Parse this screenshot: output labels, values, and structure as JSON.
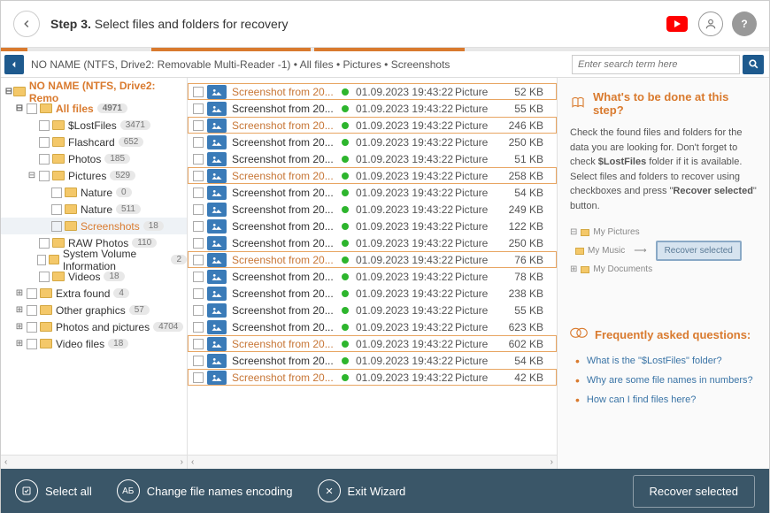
{
  "header": {
    "step": "Step 3.",
    "title": "Select files and folders for recovery"
  },
  "breadcrumb": "NO NAME (NTFS, Drive2: Removable Multi-Reader  -1)  •  All files  •  Pictures  •  Screenshots",
  "search": {
    "placeholder": "Enter search term here"
  },
  "tree": [
    {
      "lvl": 1,
      "tog": "⊟",
      "label": "NO NAME (NTFS, Drive2: Remo",
      "cls": "root"
    },
    {
      "lvl": 2,
      "tog": "⊟",
      "label": "All files",
      "cnt": "4971",
      "cls": "af"
    },
    {
      "lvl": 3,
      "tog": "",
      "label": "$LostFiles",
      "cnt": "3471"
    },
    {
      "lvl": 3,
      "tog": "",
      "label": "Flashcard",
      "cnt": "652"
    },
    {
      "lvl": 3,
      "tog": "",
      "label": "Photos",
      "cnt": "185"
    },
    {
      "lvl": 3,
      "tog": "⊟",
      "label": "Pictures",
      "cnt": "529"
    },
    {
      "lvl": 4,
      "tog": "",
      "label": "Nature",
      "cnt": "0"
    },
    {
      "lvl": 4,
      "tog": "",
      "label": "Nature",
      "cnt": "511"
    },
    {
      "lvl": 4,
      "tog": "",
      "label": "Screenshots",
      "cnt": "18",
      "cls": "sel"
    },
    {
      "lvl": 3,
      "tog": "",
      "label": "RAW Photos",
      "cnt": "110"
    },
    {
      "lvl": 3,
      "tog": "",
      "label": "System Volume Information",
      "cnt": "2"
    },
    {
      "lvl": 3,
      "tog": "",
      "label": "Videos",
      "cnt": "18"
    },
    {
      "lvl": 2,
      "tog": "⊞",
      "label": "Extra found",
      "cnt": "4"
    },
    {
      "lvl": 2,
      "tog": "⊞",
      "label": "Other graphics",
      "cnt": "57"
    },
    {
      "lvl": 2,
      "tog": "⊞",
      "label": "Photos and pictures",
      "cnt": "4704"
    },
    {
      "lvl": 2,
      "tog": "⊞",
      "label": "Video files",
      "cnt": "18"
    }
  ],
  "files": [
    {
      "hl": true,
      "name": "Screenshot from 20...",
      "date": "01.09.2023 19:43:22",
      "type": "Picture",
      "size": "52 KB"
    },
    {
      "hl": false,
      "name": "Screenshot from 20...",
      "date": "01.09.2023 19:43:22",
      "type": "Picture",
      "size": "55 KB"
    },
    {
      "hl": true,
      "name": "Screenshot from 20...",
      "date": "01.09.2023 19:43:22",
      "type": "Picture",
      "size": "246 KB"
    },
    {
      "hl": false,
      "name": "Screenshot from 20...",
      "date": "01.09.2023 19:43:22",
      "type": "Picture",
      "size": "250 KB"
    },
    {
      "hl": false,
      "name": "Screenshot from 20...",
      "date": "01.09.2023 19:43:22",
      "type": "Picture",
      "size": "51 KB"
    },
    {
      "hl": true,
      "name": "Screenshot from 20...",
      "date": "01.09.2023 19:43:22",
      "type": "Picture",
      "size": "258 KB"
    },
    {
      "hl": false,
      "name": "Screenshot from 20...",
      "date": "01.09.2023 19:43:22",
      "type": "Picture",
      "size": "54 KB"
    },
    {
      "hl": false,
      "name": "Screenshot from 20...",
      "date": "01.09.2023 19:43:22",
      "type": "Picture",
      "size": "249 KB"
    },
    {
      "hl": false,
      "name": "Screenshot from 20...",
      "date": "01.09.2023 19:43:22",
      "type": "Picture",
      "size": "122 KB"
    },
    {
      "hl": false,
      "name": "Screenshot from 20...",
      "date": "01.09.2023 19:43:22",
      "type": "Picture",
      "size": "250 KB"
    },
    {
      "hl": true,
      "name": "Screenshot from 20...",
      "date": "01.09.2023 19:43:22",
      "type": "Picture",
      "size": "76 KB"
    },
    {
      "hl": false,
      "name": "Screenshot from 20...",
      "date": "01.09.2023 19:43:22",
      "type": "Picture",
      "size": "78 KB"
    },
    {
      "hl": false,
      "name": "Screenshot from 20...",
      "date": "01.09.2023 19:43:22",
      "type": "Picture",
      "size": "238 KB"
    },
    {
      "hl": false,
      "name": "Screenshot from 20...",
      "date": "01.09.2023 19:43:22",
      "type": "Picture",
      "size": "55 KB"
    },
    {
      "hl": false,
      "name": "Screenshot from 20...",
      "date": "01.09.2023 19:43:22",
      "type": "Picture",
      "size": "623 KB"
    },
    {
      "hl": true,
      "name": "Screenshot from 20...",
      "date": "01.09.2023 19:43:22",
      "type": "Picture",
      "size": "602 KB"
    },
    {
      "hl": false,
      "name": "Screenshot from 20...",
      "date": "01.09.2023 19:43:22",
      "type": "Picture",
      "size": "54 KB"
    },
    {
      "hl": true,
      "name": "Screenshot from 20...",
      "date": "01.09.2023 19:43:22",
      "type": "Picture",
      "size": "42 KB"
    }
  ],
  "sidebar": {
    "h1": "What's to be done at this step?",
    "p1": "Check the found files and folders for the data you are looking for. Don't forget to check <b>$LostFiles</b> folder if it is available. Select files and folders to recover using checkboxes and press \"<b>Recover selected</b>\" button.",
    "ill": {
      "a": "My Pictures",
      "b": "My Music",
      "c": "My Documents",
      "btn": "Recover selected"
    },
    "faqTitle": "Frequently asked questions:",
    "faq": [
      "What is the \"$LostFiles\" folder?",
      "Why are some file names in numbers?",
      "How can I find files here?"
    ]
  },
  "footer": {
    "selectAll": "Select all",
    "encoding": "Change file names encoding",
    "exit": "Exit Wizard",
    "recover": "Recover selected"
  }
}
